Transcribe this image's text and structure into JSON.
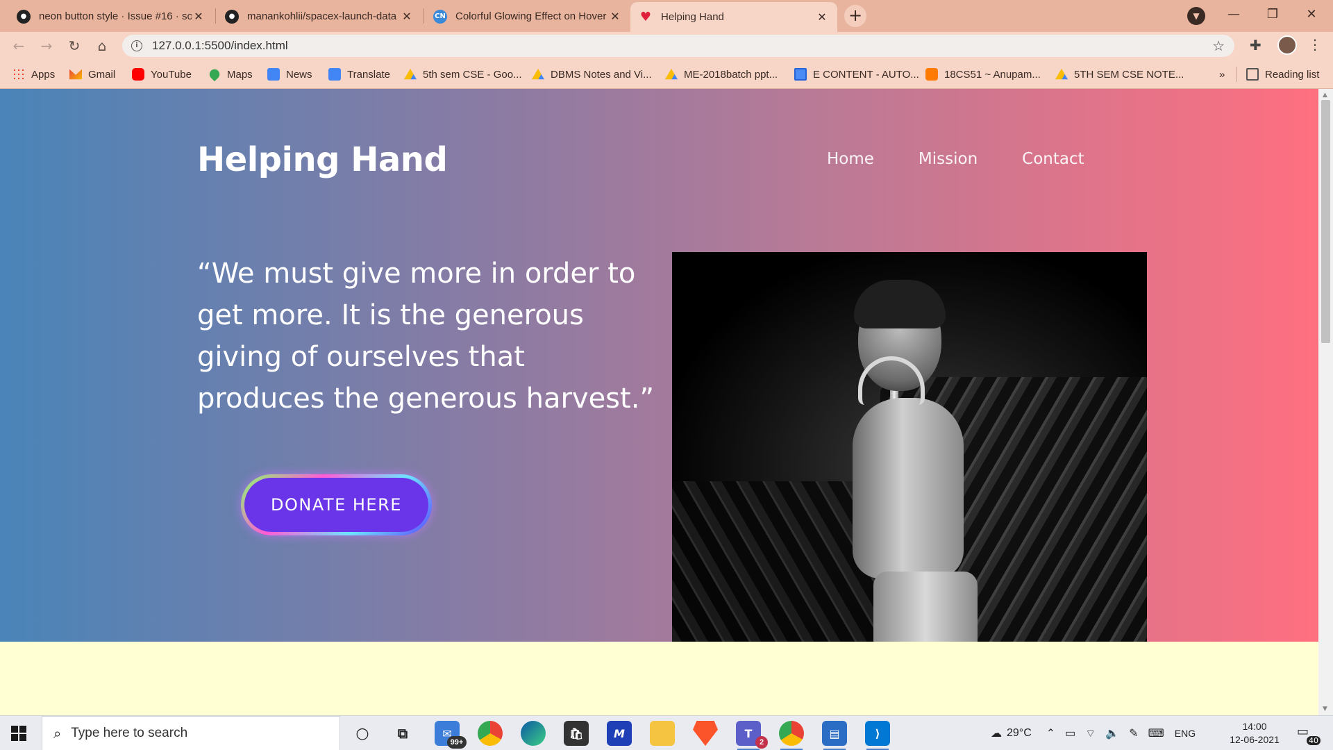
{
  "browser": {
    "tabs": [
      {
        "title": "neon button style · Issue #16 · so",
        "favicon": "github-icon"
      },
      {
        "title": "manankohlii/spacex-launch-data",
        "favicon": "github-icon"
      },
      {
        "title": "Colorful Glowing Effect on Hover",
        "favicon": "cn-icon",
        "favicon_text": "CN"
      },
      {
        "title": "Helping Hand",
        "favicon": "heart-icon",
        "active": true
      }
    ],
    "new_tab": "+",
    "url": "127.0.0.1:5500/index.html",
    "bookmarks": [
      {
        "label": "Apps",
        "icon": "apps-icon"
      },
      {
        "label": "Gmail",
        "icon": "gmail-icon"
      },
      {
        "label": "YouTube",
        "icon": "youtube-icon"
      },
      {
        "label": "Maps",
        "icon": "maps-icon"
      },
      {
        "label": "News",
        "icon": "news-icon"
      },
      {
        "label": "Translate",
        "icon": "translate-icon"
      },
      {
        "label": "5th sem CSE - Goo...",
        "icon": "drive-icon"
      },
      {
        "label": "DBMS Notes and Vi...",
        "icon": "drive-icon"
      },
      {
        "label": "ME-2018batch ppt...",
        "icon": "drive-icon"
      },
      {
        "label": "E CONTENT - AUTO...",
        "icon": "doc-icon"
      },
      {
        "label": "18CS51 ~ Anupam...",
        "icon": "blogger-icon"
      },
      {
        "label": "5TH SEM CSE NOTE...",
        "icon": "drive-icon"
      }
    ],
    "bookmarks_overflow": "»",
    "reading_list": "Reading list"
  },
  "page": {
    "brand": "Helping Hand",
    "nav": [
      "Home",
      "Mission",
      "Contact"
    ],
    "quote": "“We must give more in order to get more. It is the generous giving of ourselves that produces the generous harvest.”",
    "donate_label": "DONATE HERE",
    "colors": {
      "gradient_start": "#4a84b8",
      "gradient_end": "#ff6f80",
      "button": "#6a35e8",
      "below_section": "#ffffd3"
    }
  },
  "taskbar": {
    "search_placeholder": "Type here to search",
    "mail_badge": "99+",
    "teams_badge": "2",
    "weather": "29°C",
    "language": "ENG",
    "time": "14:00",
    "date": "12-06-2021",
    "notification_count": "40"
  }
}
